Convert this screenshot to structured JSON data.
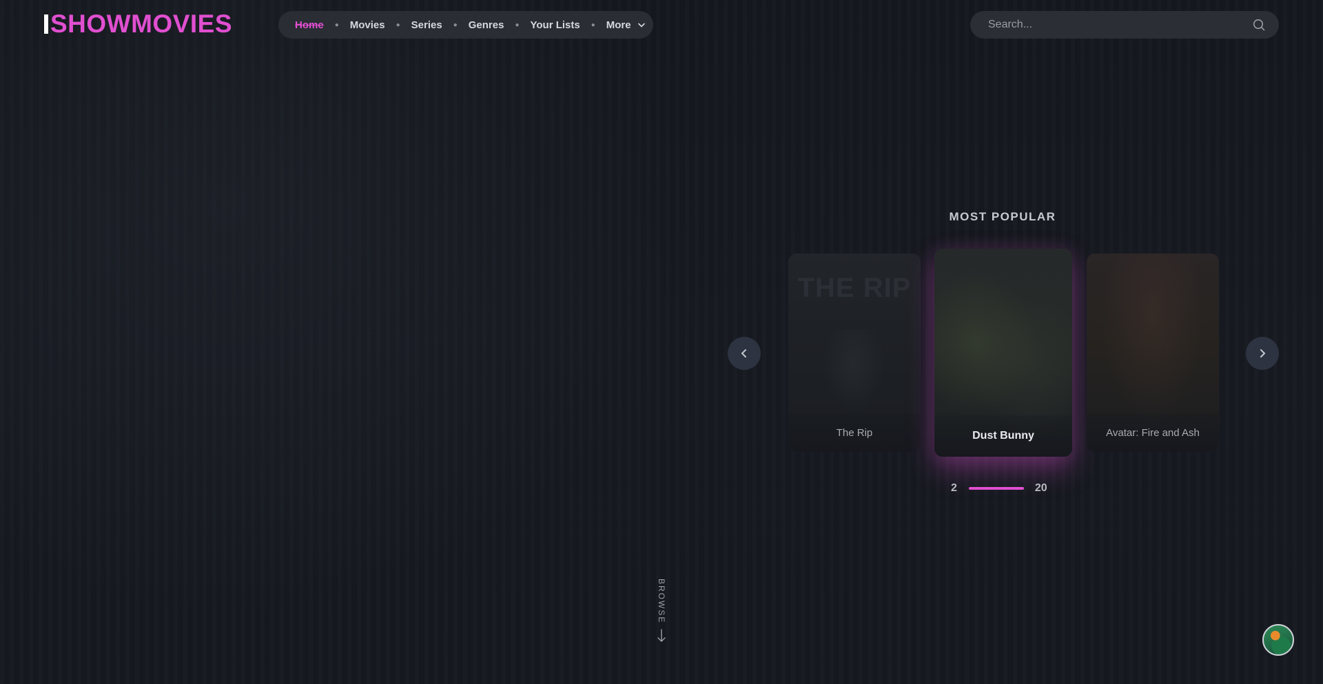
{
  "brand": {
    "name": "SHOWMOVIES",
    "accent": "#e04fd0"
  },
  "nav": {
    "items": [
      {
        "label": "Home",
        "active": true
      },
      {
        "label": "Movies"
      },
      {
        "label": "Series"
      },
      {
        "label": "Genres"
      },
      {
        "label": "Your Lists"
      },
      {
        "label": "More",
        "icon": "chevron-down-icon"
      }
    ]
  },
  "search": {
    "placeholder": "Search...",
    "icon": "search-icon"
  },
  "carousel": {
    "title": "MOST POPULAR",
    "cards": [
      {
        "title": "The Rip",
        "poster_text": "THE RIP"
      },
      {
        "title": "Dust Bunny"
      },
      {
        "title": "Avatar: Fire and Ash"
      }
    ],
    "pager": {
      "current": "2",
      "total": "20"
    },
    "prev_icon": "chevron-left-icon",
    "next_icon": "chevron-right-icon"
  },
  "browse": {
    "label": "BROWSE",
    "icon": "arrow-down-icon"
  },
  "user": {
    "avatar_icon": "avatar"
  }
}
